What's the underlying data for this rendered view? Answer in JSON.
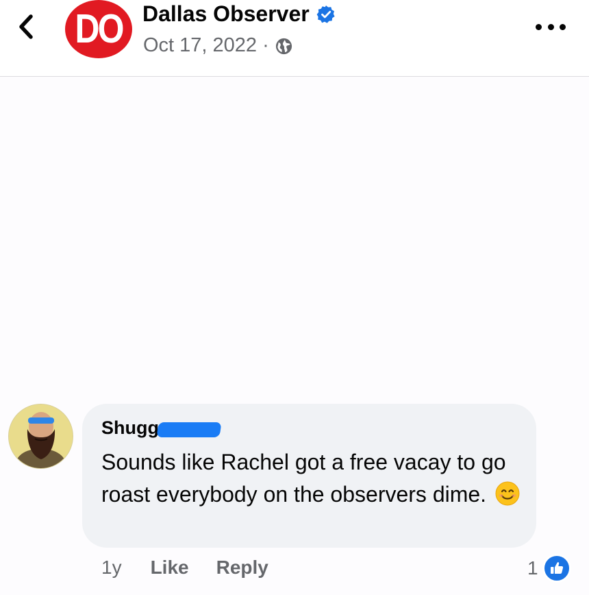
{
  "header": {
    "back_icon": "chevron-left-icon",
    "logo_text": "DO",
    "page_name": "Dallas Observer",
    "verified_icon": "verified-badge-icon",
    "date": "Oct 17, 2022",
    "separator": "·",
    "privacy_icon": "globe-icon",
    "more_icon": "more-horizontal-icon"
  },
  "comment": {
    "author": "Shugg",
    "author_redacted": true,
    "text": "Sounds like Rachel got a free vacay to go roast everybody on the observers dime.",
    "emoji_icon": "smiling-face-emoji-icon",
    "time": "1y",
    "like_label": "Like",
    "reply_label": "Reply",
    "reaction_count": "1",
    "reaction_icon": "like-thumb-icon"
  },
  "colors": {
    "brand_red": "#e11a22",
    "facebook_blue": "#1b74e4",
    "bubble_bg": "#f0f2f5",
    "secondary_text": "#65676b"
  }
}
